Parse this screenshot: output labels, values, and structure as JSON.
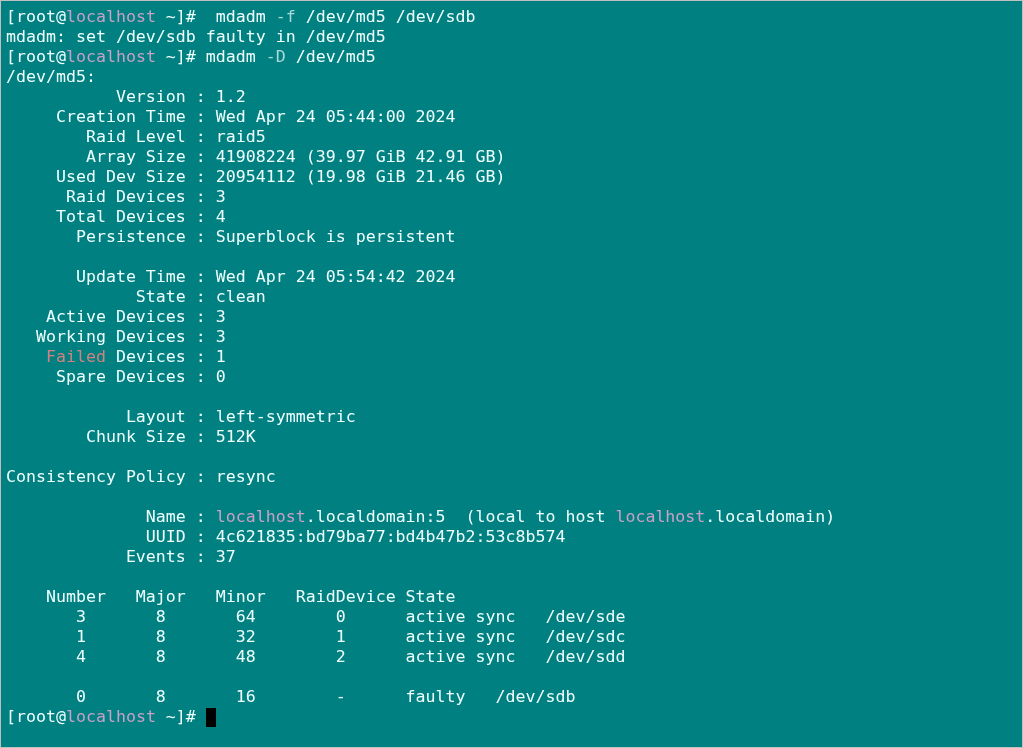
{
  "terminal": {
    "lines": [
      {
        "kind": "text",
        "segments": [
          {
            "text": "[root@"
          },
          {
            "text": "localhost",
            "color": "#c8a0c8"
          },
          {
            "text": " ~]#  mdadm "
          },
          {
            "text": "-f",
            "color": "#a8d8d8"
          },
          {
            "text": " /dev/md5 /dev/sdb"
          }
        ]
      },
      {
        "kind": "text",
        "segments": [
          {
            "text": "mdadm: set /dev/sdb faulty in /dev/md5"
          }
        ]
      },
      {
        "kind": "text",
        "segments": [
          {
            "text": "[root@"
          },
          {
            "text": "localhost",
            "color": "#c8a0c8"
          },
          {
            "text": " ~]# mdadm "
          },
          {
            "text": "-D",
            "color": "#a8d8d8"
          },
          {
            "text": " /dev/md5"
          }
        ]
      },
      {
        "kind": "text",
        "segments": [
          {
            "text": "/dev/md5:"
          }
        ]
      },
      {
        "kind": "text",
        "segments": [
          {
            "text": "           Version : 1.2"
          }
        ]
      },
      {
        "kind": "text",
        "segments": [
          {
            "text": "     Creation Time : Wed Apr 24 05:44:00 2024"
          }
        ]
      },
      {
        "kind": "text",
        "segments": [
          {
            "text": "        Raid Level : raid5"
          }
        ]
      },
      {
        "kind": "text",
        "segments": [
          {
            "text": "        Array Size : 41908224 (39.97 GiB 42.91 GB)"
          }
        ]
      },
      {
        "kind": "text",
        "segments": [
          {
            "text": "     Used Dev Size : 20954112 (19.98 GiB 21.46 GB)"
          }
        ]
      },
      {
        "kind": "text",
        "segments": [
          {
            "text": "      Raid Devices : 3"
          }
        ]
      },
      {
        "kind": "text",
        "segments": [
          {
            "text": "     Total Devices : 4"
          }
        ]
      },
      {
        "kind": "text",
        "segments": [
          {
            "text": "       Persistence : Superblock is persistent"
          }
        ]
      },
      {
        "kind": "blank"
      },
      {
        "kind": "text",
        "segments": [
          {
            "text": "       Update Time : Wed Apr 24 05:54:42 2024"
          }
        ]
      },
      {
        "kind": "text",
        "segments": [
          {
            "text": "             State : clean"
          }
        ]
      },
      {
        "kind": "text",
        "segments": [
          {
            "text": "    Active Devices : 3"
          }
        ]
      },
      {
        "kind": "text",
        "segments": [
          {
            "text": "   Working Devices : 3"
          }
        ]
      },
      {
        "kind": "text",
        "segments": [
          {
            "text": "    Failed",
            "color": "#d08282"
          },
          {
            "text": " Devices : 1"
          }
        ]
      },
      {
        "kind": "text",
        "segments": [
          {
            "text": "     Spare Devices : 0"
          }
        ]
      },
      {
        "kind": "blank"
      },
      {
        "kind": "text",
        "segments": [
          {
            "text": "            Layout : left-symmetric"
          }
        ]
      },
      {
        "kind": "text",
        "segments": [
          {
            "text": "        Chunk Size : 512K"
          }
        ]
      },
      {
        "kind": "blank"
      },
      {
        "kind": "text",
        "segments": [
          {
            "text": "Consistency Policy : resync"
          }
        ]
      },
      {
        "kind": "blank"
      },
      {
        "kind": "text",
        "segments": [
          {
            "text": "              Name : "
          },
          {
            "text": "localhost",
            "color": "#c8a0c8"
          },
          {
            "text": ".localdomain:5  (local to host "
          },
          {
            "text": "localhost",
            "color": "#c8a0c8"
          },
          {
            "text": ".localdomain)"
          }
        ]
      },
      {
        "kind": "text",
        "segments": [
          {
            "text": "              UUID : 4c621835:bd79ba77:bd4b47b2:53c8b574"
          }
        ]
      },
      {
        "kind": "text",
        "segments": [
          {
            "text": "            Events : 37"
          }
        ]
      },
      {
        "kind": "blank"
      },
      {
        "kind": "text",
        "segments": [
          {
            "text": "    Number   Major   Minor   RaidDevice State"
          }
        ]
      },
      {
        "kind": "text",
        "segments": [
          {
            "text": "       3       8       64        0      active sync   /dev/sde"
          }
        ]
      },
      {
        "kind": "text",
        "segments": [
          {
            "text": "       1       8       32        1      active sync   /dev/sdc"
          }
        ]
      },
      {
        "kind": "text",
        "segments": [
          {
            "text": "       4       8       48        2      active sync   /dev/sdd"
          }
        ]
      },
      {
        "kind": "blank"
      },
      {
        "kind": "text",
        "segments": [
          {
            "text": "       0       8       16        -      faulty   /dev/sdb"
          }
        ]
      },
      {
        "kind": "text",
        "cursor": true,
        "segments": [
          {
            "text": "[root@"
          },
          {
            "text": "localhost",
            "color": "#c8a0c8"
          },
          {
            "text": " ~]# "
          }
        ]
      }
    ]
  }
}
